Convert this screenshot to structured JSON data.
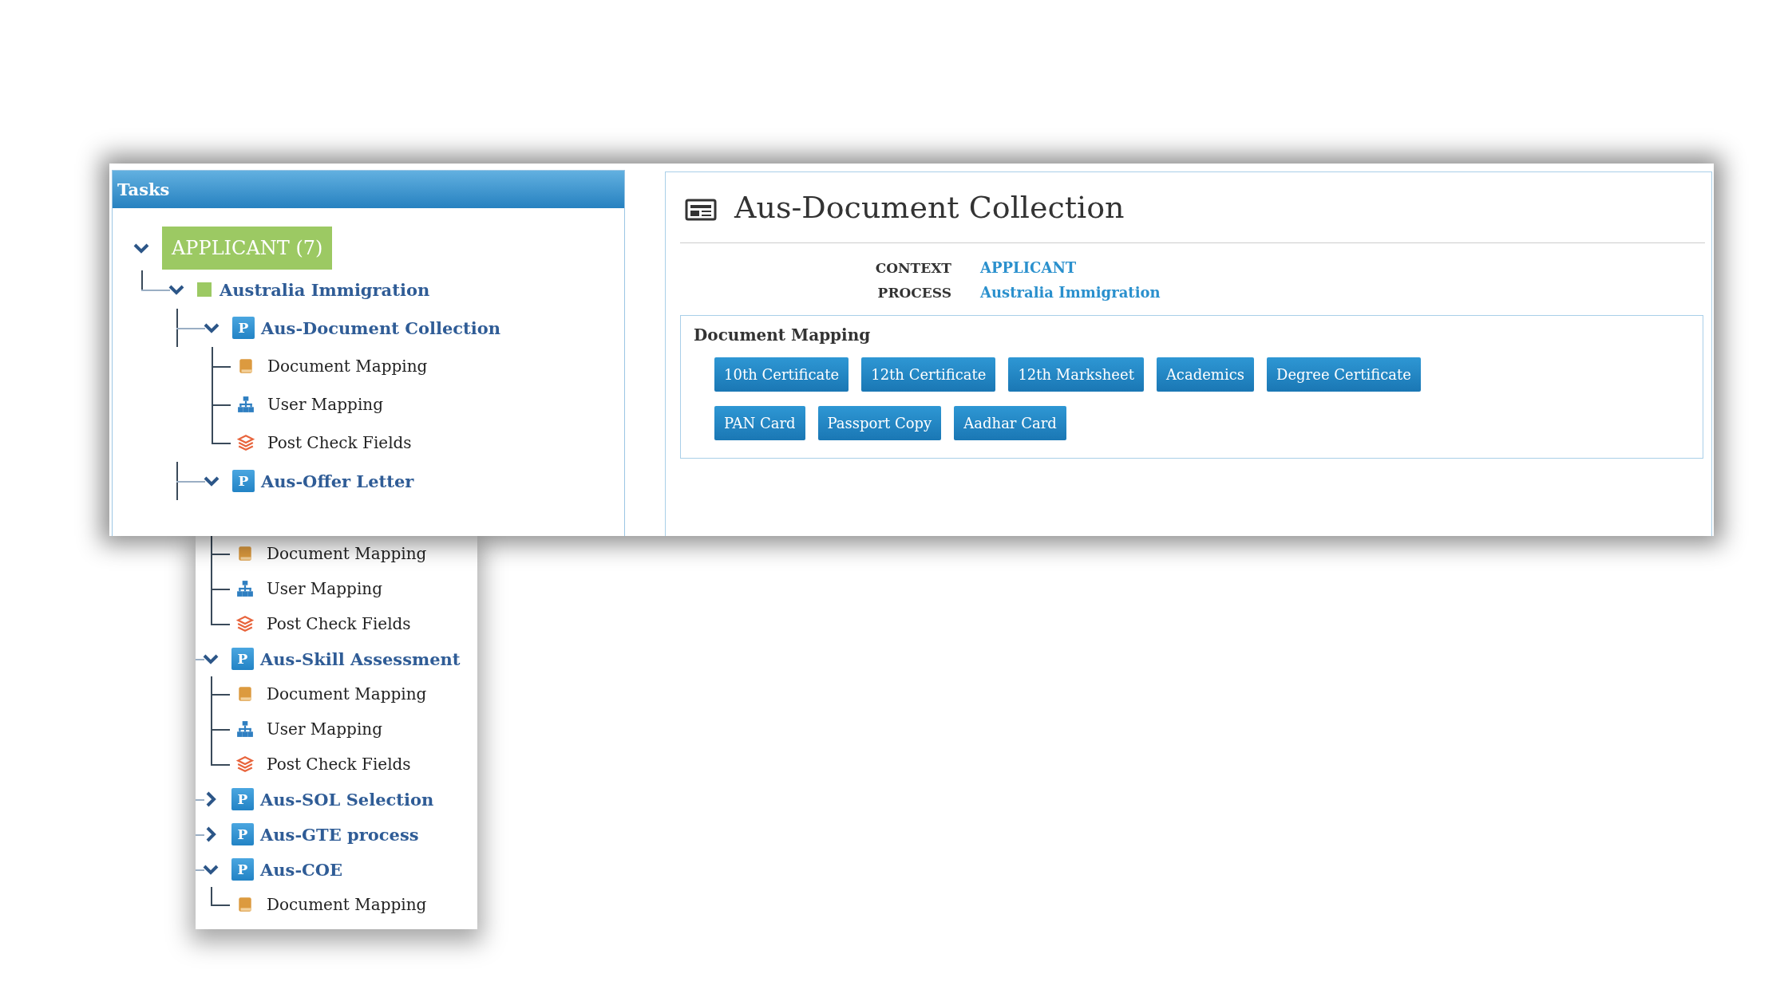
{
  "sidebar": {
    "title": "Tasks",
    "tree": [
      {
        "kind": "root",
        "label": "APPLICANT (7)",
        "expanded": true,
        "children": [
          {
            "kind": "category",
            "label": "Australia Immigration",
            "expanded": true,
            "children": [
              {
                "kind": "process",
                "badge": "P",
                "label": "Aus-Document Collection",
                "expanded": true,
                "children": [
                  {
                    "kind": "document",
                    "label": "Document Mapping"
                  },
                  {
                    "kind": "users",
                    "label": "User Mapping"
                  },
                  {
                    "kind": "check",
                    "label": "Post Check Fields"
                  }
                ]
              },
              {
                "kind": "process",
                "badge": "P",
                "label": "Aus-Offer Letter",
                "expanded": true,
                "children": [
                  {
                    "kind": "document",
                    "label": "Document Mapping"
                  },
                  {
                    "kind": "users",
                    "label": "User Mapping"
                  },
                  {
                    "kind": "check",
                    "label": "Post Check Fields"
                  }
                ]
              },
              {
                "kind": "process",
                "badge": "P",
                "label": "Aus-Skill Assessment",
                "expanded": true,
                "children": [
                  {
                    "kind": "document",
                    "label": "Document Mapping"
                  },
                  {
                    "kind": "users",
                    "label": "User Mapping"
                  },
                  {
                    "kind": "check",
                    "label": "Post Check Fields"
                  }
                ]
              },
              {
                "kind": "process",
                "badge": "P",
                "label": "Aus-SOL Selection",
                "expanded": false
              },
              {
                "kind": "process",
                "badge": "P",
                "label": "Aus-GTE process",
                "expanded": false
              },
              {
                "kind": "process",
                "badge": "P",
                "label": "Aus-COE",
                "expanded": true,
                "children": [
                  {
                    "kind": "document",
                    "label": "Document Mapping"
                  }
                ]
              }
            ]
          }
        ]
      }
    ]
  },
  "detail": {
    "title": "Aus-Document Collection",
    "fields": [
      {
        "label": "CONTEXT",
        "value": "APPLICANT"
      },
      {
        "label": "PROCESS",
        "value": "Australia Immigration"
      }
    ],
    "section": {
      "title": "Document Mapping",
      "tags": [
        "10th Certificate",
        "12th Certificate",
        "12th Marksheet",
        "Academics",
        "Degree Certificate",
        "PAN Card",
        "Passport Copy",
        "Aadhar Card"
      ]
    }
  }
}
